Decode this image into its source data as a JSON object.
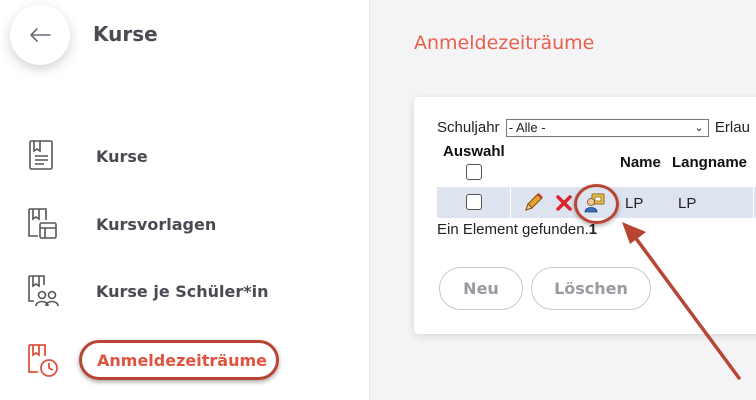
{
  "app": {
    "title": "Kurse",
    "back_icon": "arrow-left-icon"
  },
  "sidebar": {
    "items": [
      {
        "label": "Kurse",
        "icon": "course-book-icon"
      },
      {
        "label": "Kursvorlagen",
        "icon": "course-template-icon"
      },
      {
        "label": "Kurse je Schüler*in",
        "icon": "course-students-icon"
      },
      {
        "label": "Anmeldezeiträume",
        "icon": "course-calendar-icon",
        "active": true
      }
    ]
  },
  "main": {
    "title": "Anmeldezeiträume",
    "filter": {
      "label": "Schuljahr",
      "value": "- Alle -",
      "next_label": "Erlau"
    },
    "table": {
      "headers": {
        "select": "Auswahl",
        "name": "Name",
        "longname": "Langname"
      },
      "rows": [
        {
          "name": "LP",
          "longname": "LP"
        }
      ]
    },
    "status": {
      "text": "Ein Element gefunden.",
      "count": "1"
    },
    "buttons": {
      "new": "Neu",
      "delete": "Löschen"
    }
  },
  "colors": {
    "accent": "#e0533f",
    "annotation": "#b84534",
    "row_bg": "#dde3ef"
  }
}
